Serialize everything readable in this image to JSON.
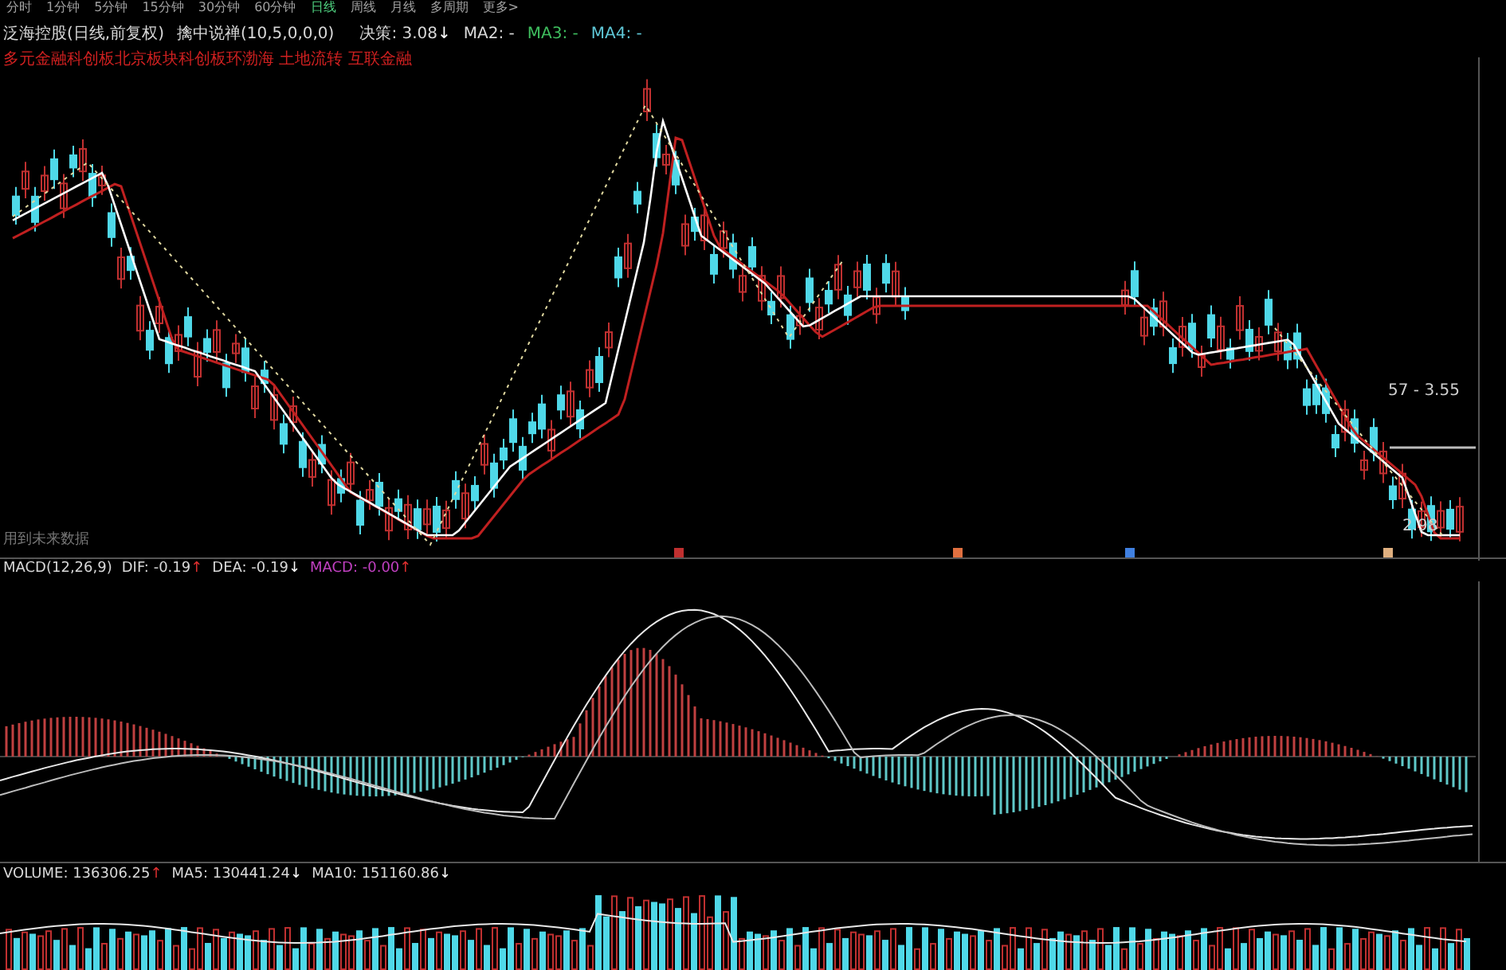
{
  "toolbar": {
    "items": [
      {
        "label": "分时",
        "selected": false
      },
      {
        "label": "1分钟",
        "selected": false
      },
      {
        "label": "5分钟",
        "selected": false
      },
      {
        "label": "15分钟",
        "selected": false
      },
      {
        "label": "30分钟",
        "selected": false
      },
      {
        "label": "60分钟",
        "selected": false
      },
      {
        "label": "日线",
        "selected": true
      },
      {
        "label": "周线",
        "selected": false
      },
      {
        "label": "月线",
        "selected": false
      },
      {
        "label": "多周期",
        "selected": false
      },
      {
        "label": "更多>",
        "selected": false
      }
    ]
  },
  "header": {
    "title": "泛海控股(日线,前复权)",
    "indicator": "擒中说禅(10,5,0,0,0)",
    "readings": [
      {
        "text": "决策: 3.08",
        "arrow": "↓",
        "rising": false,
        "color": "#d8d8d8"
      },
      {
        "text": "MA2: -",
        "color": "#d8d8d8"
      },
      {
        "text": "MA3: -",
        "color": "#3fbf5f"
      },
      {
        "text": "MA4: -",
        "color": "#5fc8d8"
      }
    ]
  },
  "tags": "多元金融科创板北京板块科创板环渤海 土地流转 互联金融",
  "price_panel": {
    "note": "用到未来数据",
    "high_label": "57 - 3.55",
    "low_label": "2.98"
  },
  "macd": {
    "title": "MACD(12,26,9)",
    "readings": [
      {
        "text": "DIF: -0.19",
        "arrow": "↑",
        "rising": true,
        "color": "#d8d8d8"
      },
      {
        "text": "DEA: -0.19",
        "arrow": "↓",
        "rising": false,
        "color": "#d8d8d8"
      },
      {
        "text": "MACD: -0.00",
        "arrow": "↑",
        "rising": true,
        "color": "#c040c0"
      }
    ]
  },
  "volume": {
    "readings": [
      {
        "text": "VOLUME: 136306.25",
        "arrow": "↑",
        "rising": true,
        "color": "#d8d8d8"
      },
      {
        "text": "MA5: 130441.24",
        "arrow": "↓",
        "rising": false,
        "color": "#d8d8d8"
      },
      {
        "text": "MA10: 151160.86",
        "arrow": "↓",
        "rising": false,
        "color": "#d8d8d8"
      }
    ]
  }
}
